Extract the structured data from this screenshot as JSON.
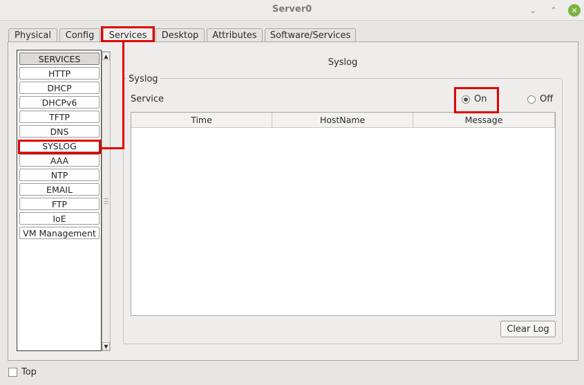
{
  "window": {
    "title": "Server0",
    "controls": {
      "minimize": "⌄",
      "maximize": "⌃",
      "close": "✕"
    }
  },
  "tabs": [
    {
      "label": "Physical"
    },
    {
      "label": "Config"
    },
    {
      "label": "Services",
      "active": true
    },
    {
      "label": "Desktop"
    },
    {
      "label": "Attributes"
    },
    {
      "label": "Software/Services"
    }
  ],
  "services_list": {
    "header": "SERVICES",
    "items": [
      "HTTP",
      "DHCP",
      "DHCPv6",
      "TFTP",
      "DNS",
      "SYSLOG",
      "AAA",
      "NTP",
      "EMAIL",
      "FTP",
      "IoE",
      "VM Management"
    ],
    "selected": "SYSLOG"
  },
  "scrollbar": {
    "up": "▲",
    "down": "▼"
  },
  "syslog": {
    "title": "Syslog",
    "group_label": "Syslog",
    "service_label": "Service",
    "on_label": "On",
    "off_label": "Off",
    "state": "On",
    "columns": [
      "Time",
      "HostName",
      "Message"
    ],
    "clear_button": "Clear Log"
  },
  "footer": {
    "top_label": "Top",
    "top_checked": false
  },
  "colors": {
    "highlight": "#e00000",
    "window_bg": "#efedeb",
    "close_button": "#7cb342"
  }
}
